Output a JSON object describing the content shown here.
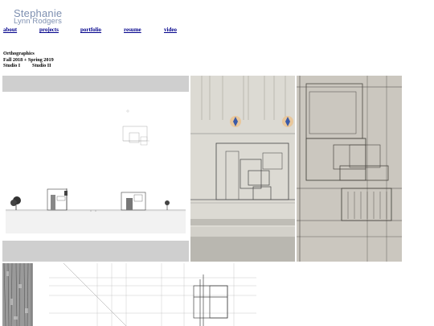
{
  "header": {
    "logo_line1": "Stephanie",
    "logo_line2": "Lynn Rodgers"
  },
  "nav": {
    "items": [
      {
        "label": "about"
      },
      {
        "label": "projects"
      },
      {
        "label": "portfolio"
      },
      {
        "label": "resume"
      },
      {
        "label": "video"
      }
    ]
  },
  "project": {
    "title": "Orthographics",
    "semesters": "Fall 2018 + Spring 2019",
    "studios": [
      "Studio I",
      "Studio II"
    ]
  },
  "colors": {
    "logo": "#7d8fb0",
    "link": "#00008b",
    "page_bg": "#ffffff"
  },
  "gallery": {
    "images": [
      {
        "name": "site-section-drawing"
      },
      {
        "name": "elevation-photo-with-compass"
      },
      {
        "name": "facade-elevation-photo"
      },
      {
        "name": "pencil-texture-study"
      },
      {
        "name": "line-grid-drawing"
      }
    ]
  }
}
